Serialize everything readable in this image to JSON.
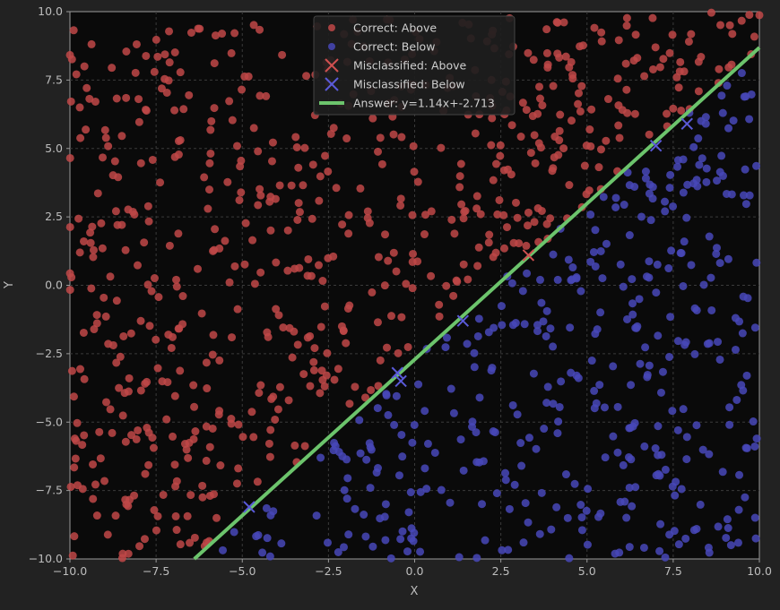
{
  "chart_data": {
    "type": "scatter",
    "title": "",
    "xlabel": "X",
    "ylabel": "Y",
    "xlim": [
      -10,
      10
    ],
    "ylim": [
      -10,
      10
    ],
    "xticks": [
      "−10.0",
      "−7.5",
      "−5.0",
      "−2.5",
      "0.0",
      "2.5",
      "5.0",
      "7.5",
      "10.0"
    ],
    "yticks": [
      "−10.0",
      "−7.5",
      "−5.0",
      "−2.5",
      "0.0",
      "2.5",
      "5.0",
      "7.5",
      "10.0"
    ],
    "grid": true,
    "legend_position": "top-center",
    "line": {
      "name": "Answer: y=1.14x+-2.713",
      "slope": 1.14,
      "intercept": -2.713,
      "color": "#6cc46c"
    },
    "series": [
      {
        "name": "Correct: Above",
        "marker": "circle",
        "color": "#c04848",
        "count_estimate": 620
      },
      {
        "name": "Correct: Below",
        "marker": "circle",
        "color": "#4848b8",
        "count_estimate": 420
      },
      {
        "name": "Misclassified: Above",
        "marker": "x",
        "color": "#c04848",
        "points": [
          [
            3.3,
            1.1
          ]
        ]
      },
      {
        "name": "Misclassified: Below",
        "marker": "x",
        "color": "#4848b8",
        "points": [
          [
            -4.8,
            -8.1
          ],
          [
            -0.5,
            -3.2
          ],
          [
            -0.4,
            -3.5
          ],
          [
            1.4,
            -1.3
          ],
          [
            7.0,
            5.1
          ],
          [
            7.9,
            5.9
          ]
        ]
      }
    ]
  }
}
